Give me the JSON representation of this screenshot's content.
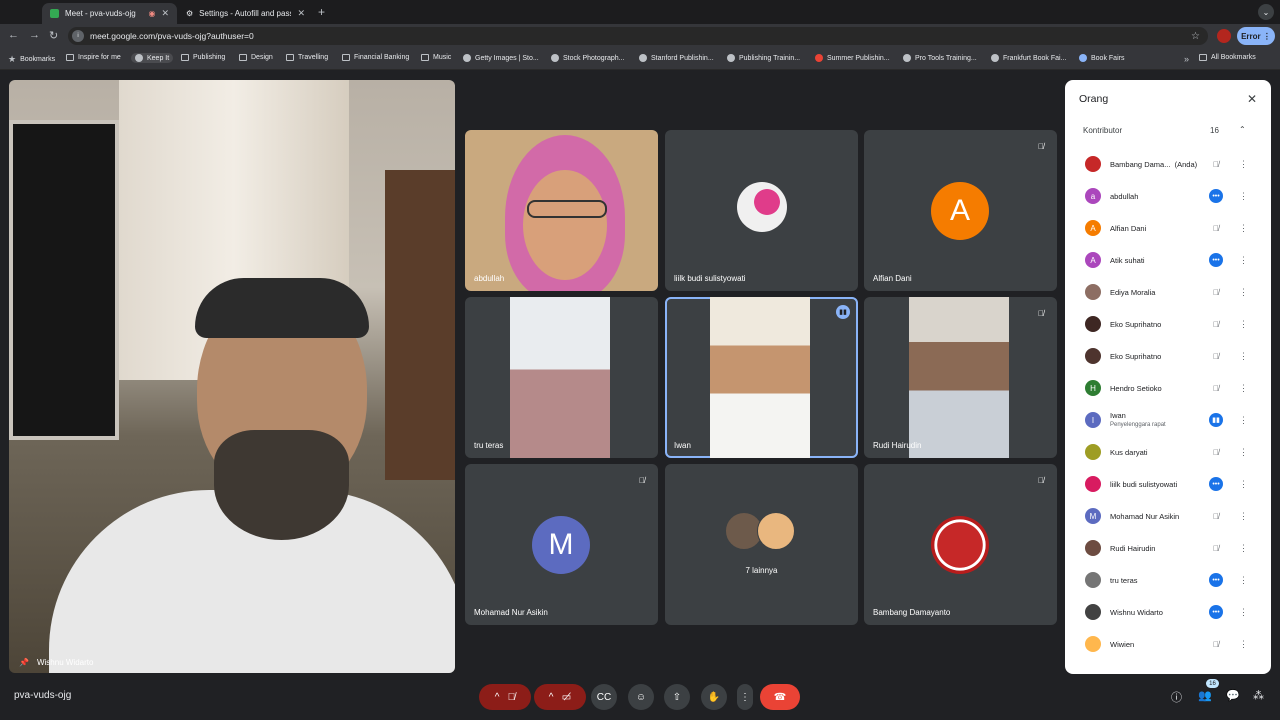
{
  "browser": {
    "tabs": [
      {
        "title": "Meet - pva-vuds-ojg",
        "active": true
      },
      {
        "title": "Settings - Autofill and passw",
        "active": false
      }
    ],
    "url": "meet.google.com/pva-vuds-ojg?authuser=0",
    "error_label": "Error",
    "bookmarks": [
      "Bookmarks",
      "Inspire for me",
      "Keep It",
      "Publishing",
      "Design",
      "Travelling",
      "Financial Banking",
      "Music",
      "Getty Images | Sto...",
      "Stock Photograph...",
      "Stanford Publishin...",
      "Publishing Trainin...",
      "Summer Publishin...",
      "Pro Tools Training...",
      "Frankfurt Book Fai...",
      "Book Fairs"
    ],
    "all_bookmarks": "All Bookmarks"
  },
  "meet": {
    "main_speaker": "Wishnu Widarto",
    "tiles": [
      {
        "name": "abdullah"
      },
      {
        "name": "liilk budi sulistyowati"
      },
      {
        "name": "Alfian Dani",
        "initial": "A",
        "color": "#f57c00"
      },
      {
        "name": "tru teras"
      },
      {
        "name": "Iwan"
      },
      {
        "name": "Rudi Hairudin"
      },
      {
        "name": "Mohamad Nur Asikin",
        "initial": "M",
        "color": "#5c6bc0"
      },
      {
        "name": "7 lainnya"
      },
      {
        "name": "Bambang Damayanto"
      }
    ],
    "meeting_code": "pva-vuds-ojg",
    "people_badge": "16"
  },
  "panel": {
    "title": "Orang",
    "section": "Kontributor",
    "count": "16",
    "people": [
      {
        "name": "Bambang Dama...",
        "suffix": "(Anda)",
        "avatar": "photo",
        "color": "#c62828",
        "status": "muted"
      },
      {
        "name": "abdullah",
        "avatar": "a",
        "color": "#ab47bc",
        "status": "dots"
      },
      {
        "name": "Alfian Dani",
        "avatar": "A",
        "color": "#f57c00",
        "status": "muted"
      },
      {
        "name": "Atik suhati",
        "avatar": "A",
        "color": "#ab47bc",
        "status": "dots"
      },
      {
        "name": "Ediya Moralia",
        "avatar": "photo",
        "color": "#8d6e63",
        "status": "muted"
      },
      {
        "name": "Eko Suprihatno",
        "avatar": "photo",
        "color": "#3e2723",
        "status": "muted"
      },
      {
        "name": "Eko Suprihatno",
        "avatar": "photo",
        "color": "#4e342e",
        "status": "muted"
      },
      {
        "name": "Hendro Setioko",
        "avatar": "H",
        "color": "#2e7d32",
        "status": "muted"
      },
      {
        "name": "Iwan",
        "sub": "Penyelenggara rapat",
        "avatar": "I",
        "color": "#5c6bc0",
        "status": "live"
      },
      {
        "name": "Kus daryati",
        "avatar": "photo",
        "color": "#9e9d24",
        "status": "muted"
      },
      {
        "name": "liilk budi sulistyowati",
        "avatar": "photo",
        "color": "#d81b60",
        "status": "dots"
      },
      {
        "name": "Mohamad Nur Asikin",
        "avatar": "M",
        "color": "#5c6bc0",
        "status": "muted"
      },
      {
        "name": "Rudi Hairudin",
        "avatar": "photo",
        "color": "#6d4c41",
        "status": "muted"
      },
      {
        "name": "tru teras",
        "avatar": "photo",
        "color": "#757575",
        "status": "dots"
      },
      {
        "name": "Wishnu Widarto",
        "avatar": "photo",
        "color": "#424242",
        "status": "dots"
      },
      {
        "name": "Wiwien",
        "avatar": "photo",
        "color": "#ffb74d",
        "status": "muted"
      }
    ]
  }
}
